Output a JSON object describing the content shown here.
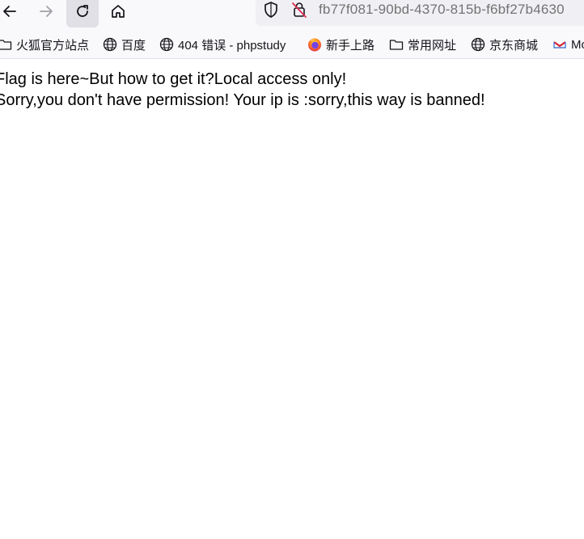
{
  "toolbar": {
    "back_icon": "arrow-left-icon",
    "forward_icon": "arrow-right-icon",
    "reload_icon": "reload-icon",
    "home_icon": "home-icon",
    "url": "fb77f081-90bd-4370-815b-f6bf27b4630",
    "shield_icon": "shield-icon",
    "insecure_lock_icon": "insecure-lock-icon"
  },
  "bookmarks": [
    {
      "label": "火狐官方站点",
      "icon": "folder-icon"
    },
    {
      "label": "百度",
      "icon": "globe-icon"
    },
    {
      "label": "404 错误 - phpstudy",
      "icon": "globe-icon"
    },
    {
      "label": "新手上路",
      "icon": "firefox-icon"
    },
    {
      "label": "常用网址",
      "icon": "folder-icon"
    },
    {
      "label": "京东商城",
      "icon": "globe-icon"
    },
    {
      "label": "Mo",
      "icon": "site-icon"
    }
  ],
  "content": {
    "line1": "Flag is here~But how to get it?Local access only!",
    "line2": "Sorry,you don't have permission! Your ip is :sorry,this way is banned!"
  },
  "colors": {
    "toolbar_bg": "#f9f9fb",
    "urlbar_bg": "#f0f0f4",
    "url_text": "#737373",
    "insecure_red": "#e22850"
  }
}
